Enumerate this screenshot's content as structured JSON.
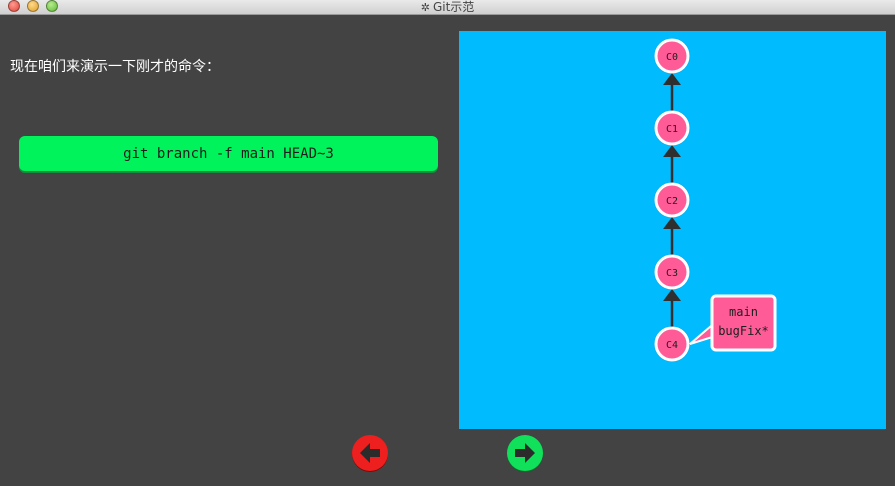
{
  "window": {
    "title": "Git示范",
    "title_icon": "gear-icon"
  },
  "instruction": "现在咱们来演示一下刚才的命令：",
  "command": "git branch -f main HEAD~3",
  "graph": {
    "commits": [
      {
        "id": "C0"
      },
      {
        "id": "C1"
      },
      {
        "id": "C2"
      },
      {
        "id": "C3"
      },
      {
        "id": "C4"
      }
    ],
    "branch_label": {
      "lines": [
        "main",
        "bugFix*"
      ],
      "points_to": "C4"
    }
  },
  "nav": {
    "back_icon": "arrow-left-icon",
    "forward_icon": "arrow-right-icon"
  },
  "colors": {
    "background": "#434343",
    "viz_background": "#00bcff",
    "commit_fill": "#ff5c97",
    "command_box": "#00f35a",
    "back_button": "#ee1f1f",
    "forward_button": "#11e05a"
  }
}
